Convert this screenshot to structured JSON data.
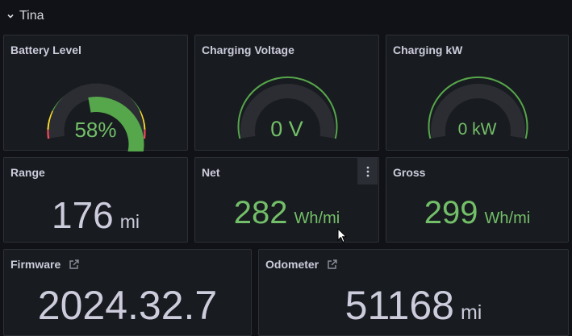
{
  "row": {
    "title": "Tina"
  },
  "colors": {
    "green": "#73bf69",
    "gaugeGreen": "#56a64b",
    "track": "#2b2d33",
    "yellow": "#fade2a",
    "red": "#f2495c",
    "white": "#ccccdc"
  },
  "panels": {
    "battery": {
      "title": "Battery Level",
      "value": "58%",
      "level": 0.58
    },
    "voltage": {
      "title": "Charging Voltage",
      "value": "0 V",
      "level": 0
    },
    "kw": {
      "title": "Charging kW",
      "value": "0 kW",
      "level": 0
    },
    "range": {
      "title": "Range",
      "value": "176",
      "unit": "mi"
    },
    "net": {
      "title": "Net",
      "value": "282",
      "unit": "Wh/mi"
    },
    "gross": {
      "title": "Gross",
      "value": "299",
      "unit": "Wh/mi"
    },
    "firmware": {
      "title": "Firmware",
      "value": "2024.32.7"
    },
    "odometer": {
      "title": "Odometer",
      "value": "51168",
      "unit": "mi"
    }
  },
  "icons": {
    "row_toggle": "chevron-down-icon",
    "panel_link": "external-link-icon",
    "panel_menu": "more-vertical-icon",
    "cursor": "mouse-cursor-icon"
  }
}
